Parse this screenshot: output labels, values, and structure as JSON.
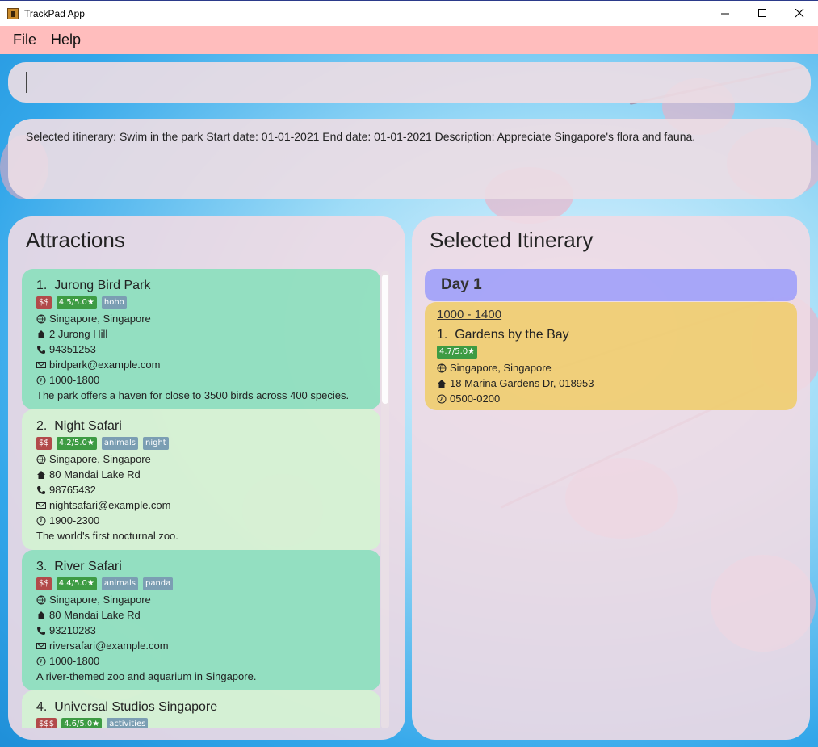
{
  "window": {
    "title": "TrackPad App",
    "controls": {
      "minimize": "—",
      "maximize": "☐",
      "close": "✕"
    }
  },
  "menu": {
    "items": [
      "File",
      "Help"
    ]
  },
  "command": {
    "value": ""
  },
  "result": {
    "text": "Selected itinerary: Swim in the park Start date: 01-01-2021 End date: 01-01-2021 Description: Appreciate Singapore's flora and fauna."
  },
  "attractions": {
    "title": "Attractions",
    "items": [
      {
        "index": "1.",
        "name": "Jurong Bird Park",
        "price": "$$",
        "rating": "4.5/5.0★",
        "tags": [
          "hoho"
        ],
        "location": "Singapore, Singapore",
        "address": "2 Jurong Hill",
        "phone": "94351253",
        "email": "birdpark@example.com",
        "hours": "1000-1800",
        "description": "The park offers a haven for close to 3500 birds across 400 species."
      },
      {
        "index": "2.",
        "name": "Night Safari",
        "price": "$$",
        "rating": "4.2/5.0★",
        "tags": [
          "animals",
          "night"
        ],
        "location": "Singapore, Singapore",
        "address": "80 Mandai Lake Rd",
        "phone": "98765432",
        "email": "nightsafari@example.com",
        "hours": "1900-2300",
        "description": "The world's first nocturnal zoo."
      },
      {
        "index": "3.",
        "name": "River Safari",
        "price": "$$",
        "rating": "4.4/5.0★",
        "tags": [
          "animals",
          "panda"
        ],
        "location": "Singapore, Singapore",
        "address": "80 Mandai Lake Rd",
        "phone": "93210283",
        "email": "riversafari@example.com",
        "hours": "1000-1800",
        "description": "A river-themed zoo and aquarium in Singapore."
      },
      {
        "index": "4.",
        "name": "Universal Studios Singapore",
        "price": "$$$",
        "rating": "4.6/5.0★",
        "tags": [
          "activities"
        ]
      }
    ]
  },
  "itinerary": {
    "title": "Selected Itinerary",
    "day": "Day 1",
    "slot": {
      "time": "1000 - 1400",
      "index": "1.",
      "name": "Gardens by the Bay",
      "rating": "4.7/5.0★",
      "location": "Singapore, Singapore",
      "address": "18 Marina Gardens Dr, 018953",
      "hours": "0500-0200"
    }
  },
  "colors": {
    "menubar": "#ffbdbd",
    "card_green": "#8ce0be",
    "card_light": "#d2f6d0",
    "day_header": "#a0a0fa",
    "itinerary_card": "#f0cd6e",
    "tag_price": "#b24a4a",
    "tag_rating": "#3d9b43",
    "tag_label": "#7b9eb3"
  }
}
